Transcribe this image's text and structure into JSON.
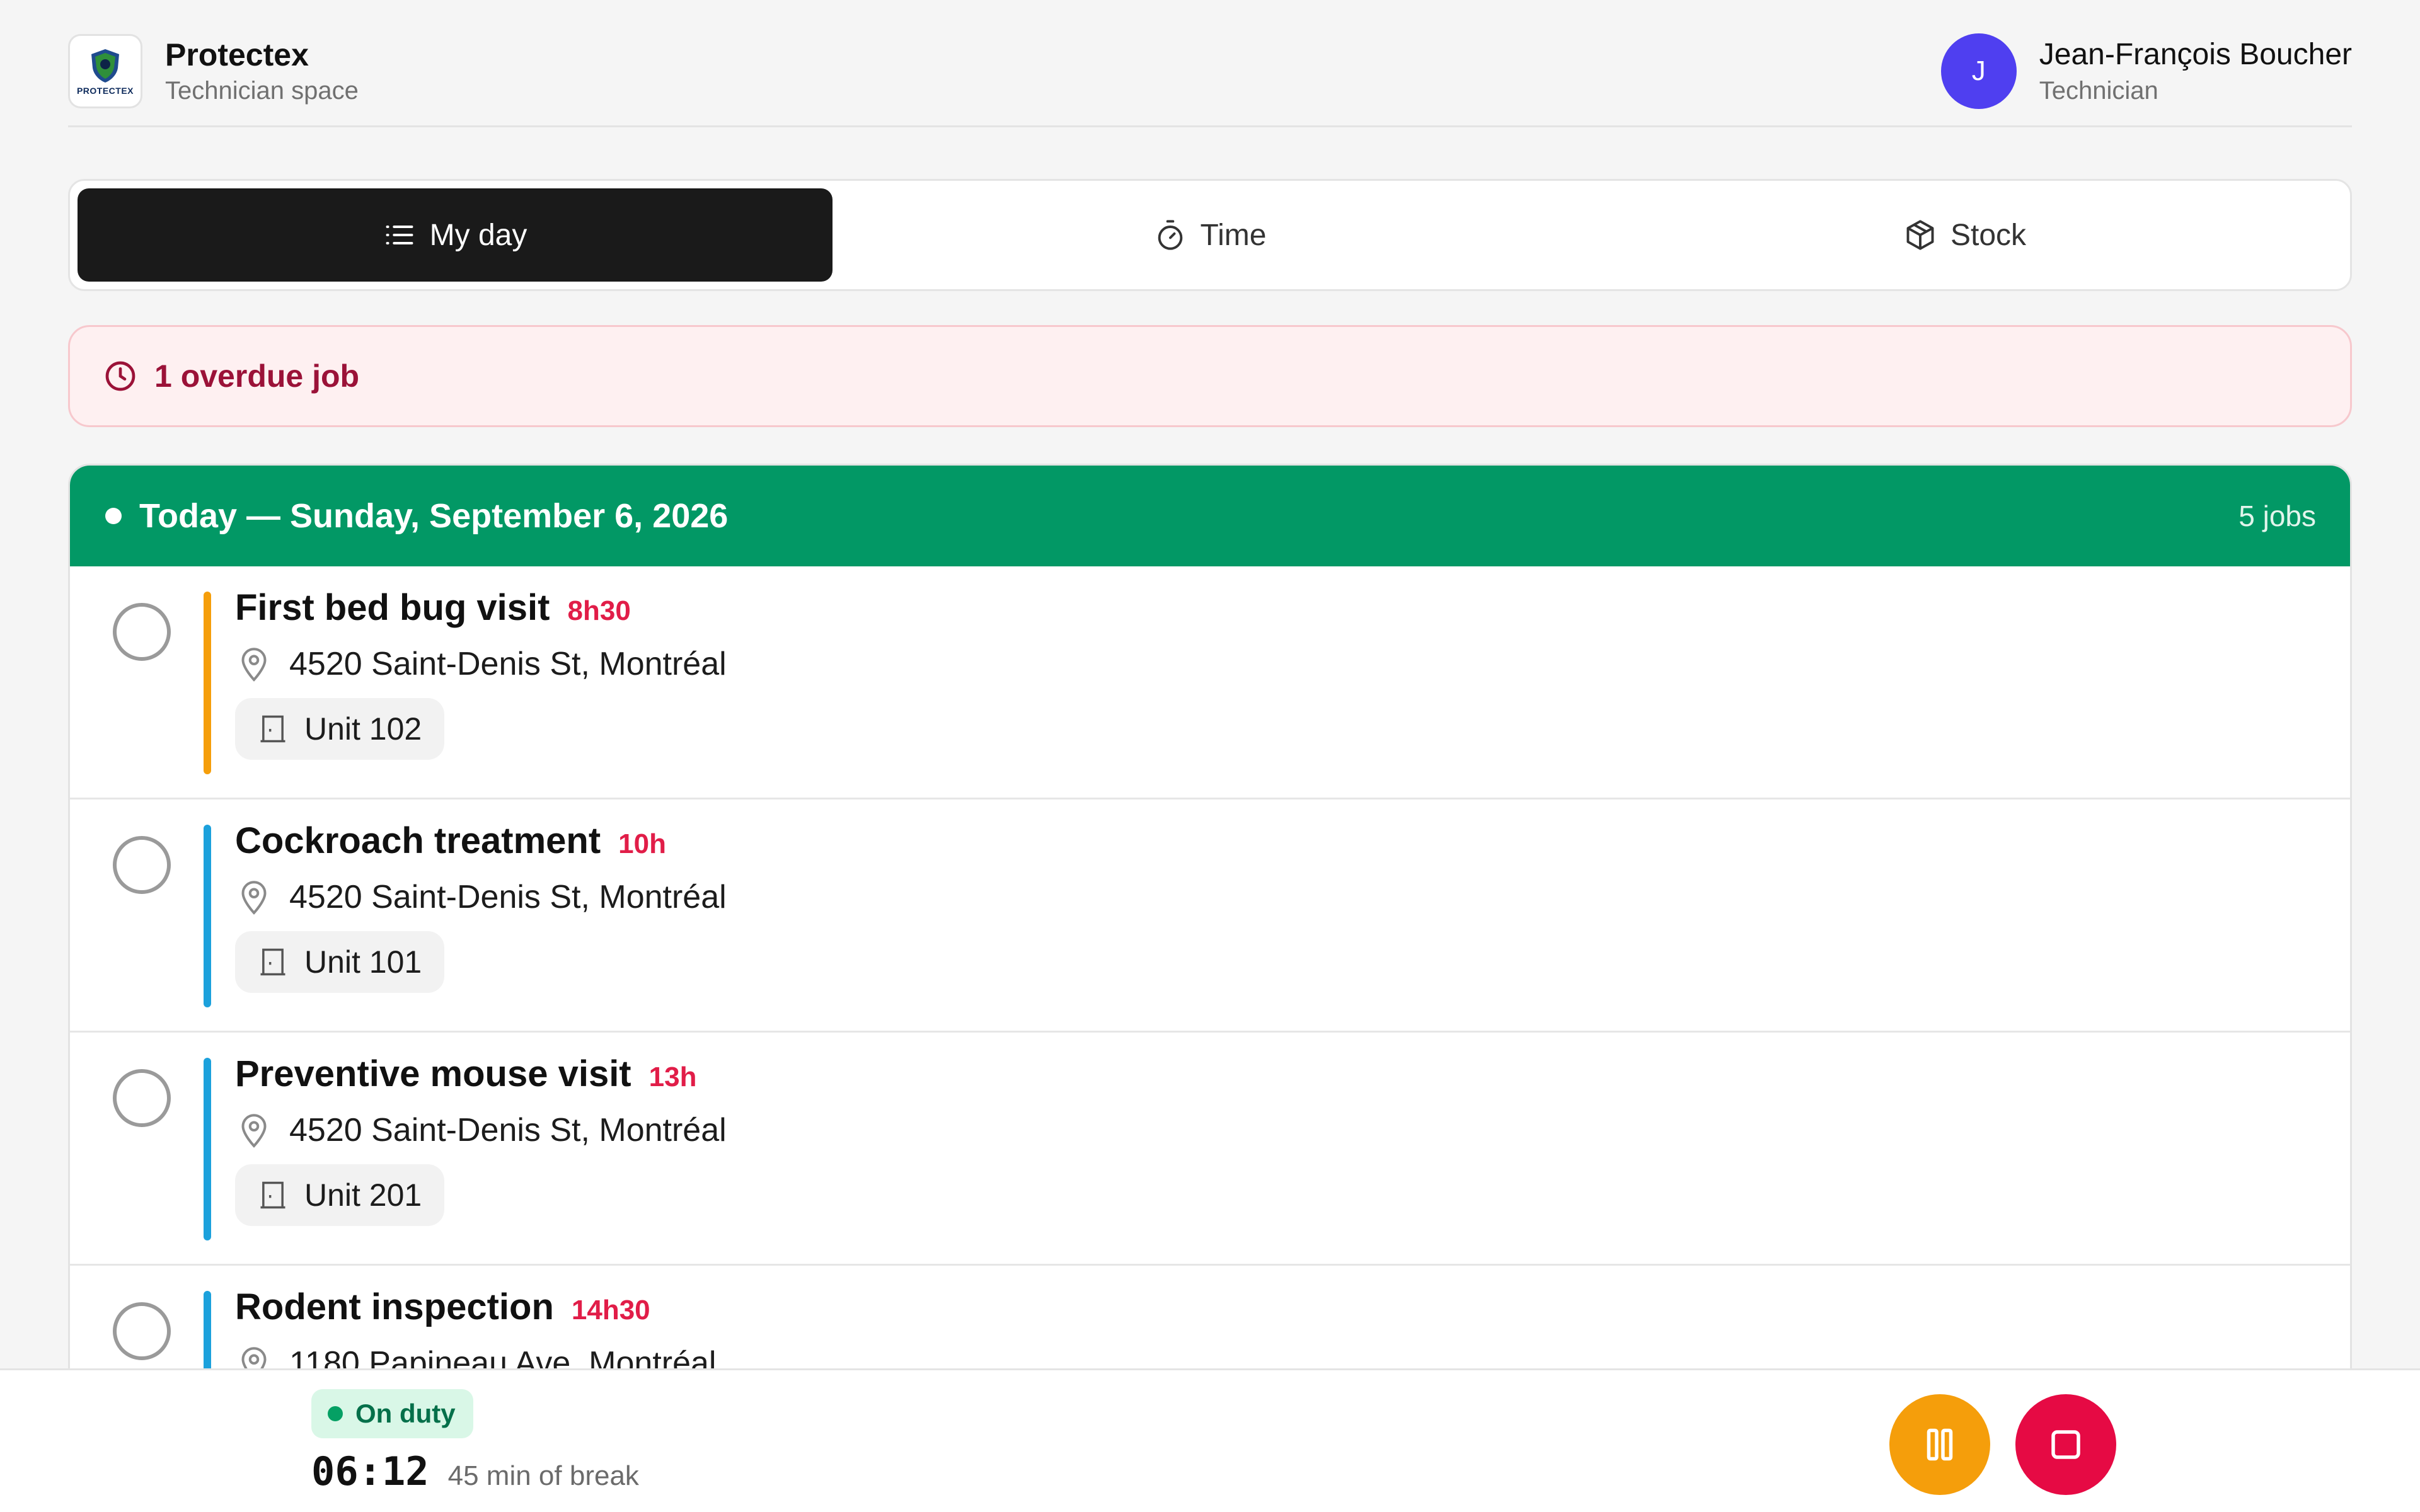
{
  "header": {
    "logo_text": "PROTECTEX",
    "brand": "Protectex",
    "subtitle": "Technician space",
    "user": {
      "initial": "J",
      "name": "Jean-François Boucher",
      "role": "Technician"
    }
  },
  "tabs": [
    {
      "label": "My day",
      "icon": "list-icon",
      "active": true
    },
    {
      "label": "Time",
      "icon": "stopwatch-icon",
      "active": false
    },
    {
      "label": "Stock",
      "icon": "box-icon",
      "active": false
    }
  ],
  "overdue": {
    "text": "1 overdue job",
    "icon": "clock-icon"
  },
  "day": {
    "title": "Today — Sunday, September 6, 2026",
    "count": "5 jobs",
    "jobs": [
      {
        "title": "First bed bug visit",
        "time": "8h30",
        "address": "4520 Saint-Denis St, Montréal",
        "unit": "Unit 102",
        "color": "#f59e0b"
      },
      {
        "title": "Cockroach treatment",
        "time": "10h",
        "address": "4520 Saint-Denis St, Montréal",
        "unit": "Unit 101",
        "color": "#1ca1dc"
      },
      {
        "title": "Preventive mouse visit",
        "time": "13h",
        "address": "4520 Saint-Denis St, Montréal",
        "unit": "Unit 201",
        "color": "#1ca1dc"
      },
      {
        "title": "Rodent inspection",
        "time": "14h30",
        "address": "1180 Papineau Ave, Montréal",
        "unit": "",
        "color": "#1ca1dc"
      }
    ]
  },
  "status": {
    "badge": "On duty",
    "timer": "06:12",
    "break": "45 min of break",
    "pause_icon": "pause-icon",
    "stop_icon": "stop-icon"
  },
  "colors": {
    "accent_green": "#029865",
    "overdue_text": "#9b1238",
    "time_red": "#e11d48",
    "avatar": "#4f3ff0",
    "pause": "#f59e0b",
    "stop": "#e60a44"
  }
}
